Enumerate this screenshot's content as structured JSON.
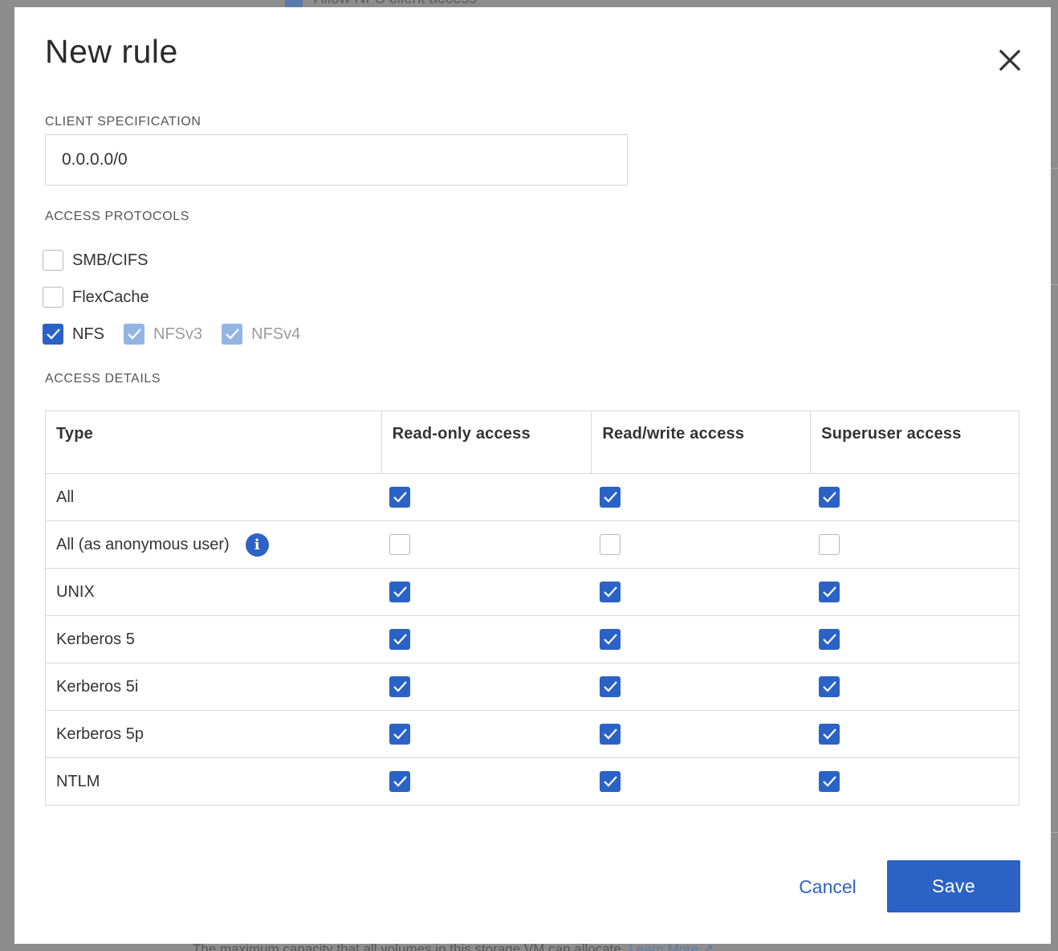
{
  "background": {
    "top_checkbox_label": "Allow NFS client access",
    "bottom_text": "The maximum capacity that all volumes in this storage VM can allocate.",
    "bottom_link": "Learn More"
  },
  "modal": {
    "title": "New rule",
    "close_icon": "close-icon"
  },
  "client_spec": {
    "label": "CLIENT SPECIFICATION",
    "value": "0.0.0.0/0"
  },
  "access_protocols": {
    "label": "ACCESS PROTOCOLS",
    "items": [
      {
        "label": "SMB/CIFS",
        "checked": false,
        "disabled": false
      },
      {
        "label": "FlexCache",
        "checked": false,
        "disabled": false
      },
      {
        "label": "NFS",
        "checked": true,
        "disabled": false
      },
      {
        "label": "NFSv3",
        "checked": true,
        "disabled": true
      },
      {
        "label": "NFSv4",
        "checked": true,
        "disabled": true
      }
    ]
  },
  "access_details": {
    "label": "ACCESS DETAILS",
    "columns": [
      "Type",
      "Read-only access",
      "Read/write access",
      "Superuser access"
    ],
    "rows": [
      {
        "type": "All",
        "read_only": true,
        "read_write": true,
        "superuser": true
      },
      {
        "type": "All (as anonymous user)",
        "read_only": false,
        "read_write": false,
        "superuser": false,
        "info_icon": "info-icon"
      },
      {
        "type": "UNIX",
        "read_only": true,
        "read_write": true,
        "superuser": true
      },
      {
        "type": "Kerberos 5",
        "read_only": true,
        "read_write": true,
        "superuser": true
      },
      {
        "type": "Kerberos 5i",
        "read_only": true,
        "read_write": true,
        "superuser": true
      },
      {
        "type": "Kerberos 5p",
        "read_only": true,
        "read_write": true,
        "superuser": true
      },
      {
        "type": "NTLM",
        "read_only": true,
        "read_write": true,
        "superuser": true
      }
    ]
  },
  "footer": {
    "cancel_label": "Cancel",
    "save_label": "Save"
  },
  "colors": {
    "accent": "#2b62c6",
    "disabled_check": "#93b5e3",
    "overlay": "#8d8d8d",
    "border": "#d9d9d9"
  }
}
